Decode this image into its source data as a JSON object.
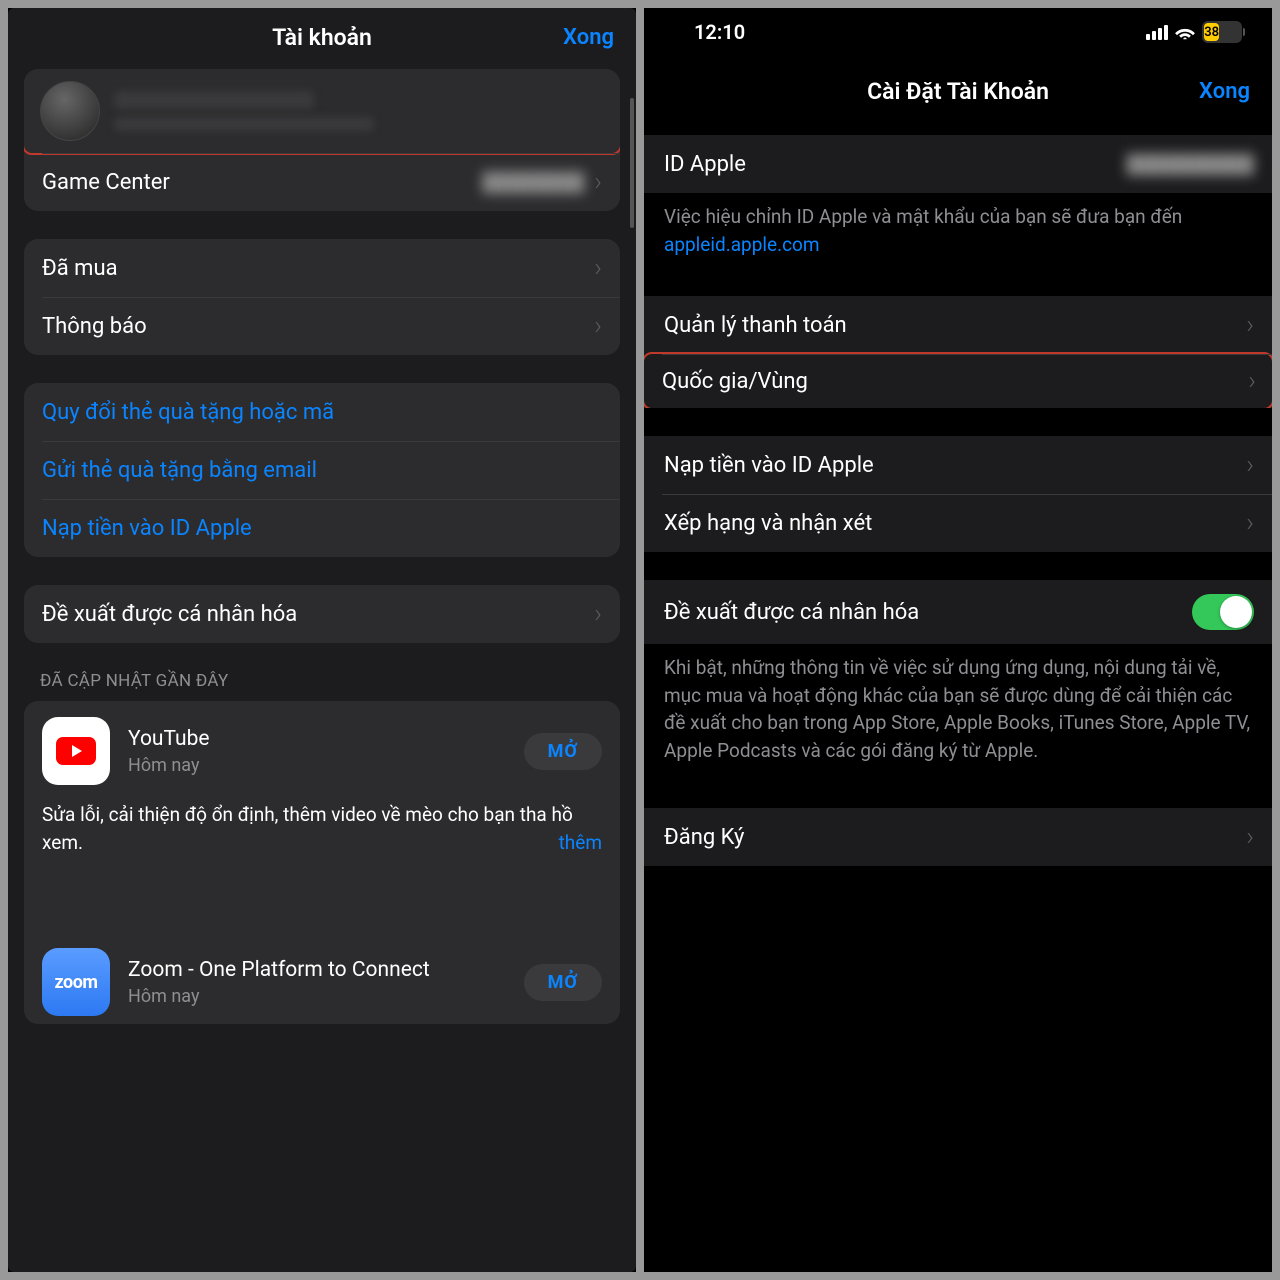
{
  "left": {
    "nav": {
      "title": "Tài khoản",
      "done": "Xong"
    },
    "profile": {
      "name_blur": "████████",
      "sub_blur": "████████████"
    },
    "gamecenter": {
      "label": "Game Center",
      "value_blur": "██████"
    },
    "rows2": {
      "purchased": "Đã mua",
      "notifications": "Thông báo"
    },
    "links": {
      "redeem": "Quy đổi thẻ quà tặng hoặc mã",
      "send_gift": "Gửi thẻ quà tặng bằng email",
      "add_funds": "Nạp tiền vào ID Apple"
    },
    "personalized": "Đề xuất được cá nhân hóa",
    "updates_header": "ĐÃ CẬP NHẬT GẦN ĐÂY",
    "youtube": {
      "name": "YouTube",
      "sub": "Hôm nay",
      "open": "Mở",
      "desc": "Sửa lỗi, cải thiện độ ổn định, thêm video về mèo cho bạn tha hồ xem.",
      "more": "thêm"
    },
    "zoom": {
      "name": "Zoom - One Platform to Connect",
      "sub": "Hôm nay",
      "open": "Mở"
    }
  },
  "right": {
    "status": {
      "time": "12:10",
      "battery": "38"
    },
    "nav": {
      "title": "Cài Đặt Tài Khoản",
      "done": "Xong"
    },
    "apple_id": {
      "label": "ID Apple",
      "value_blur": "████████"
    },
    "id_footer_pre": "Việc hiệu chỉnh ID Apple và mật khẩu của bạn sẽ đưa bạn đến ",
    "id_footer_link": "appleid.apple.com",
    "payment": "Quản lý thanh toán",
    "country": "Quốc gia/Vùng",
    "add_funds": "Nạp tiền vào ID Apple",
    "ratings": "Xếp hạng và nhận xét",
    "personalized": "Đề xuất được cá nhân hóa",
    "personalized_footer": "Khi bật, những thông tin về việc sử dụng ứng dụng, nội dung tải về, mục mua và hoạt động khác của bạn sẽ được dùng để cải thiện các đề xuất cho bạn trong App Store, Apple Books, iTunes Store, Apple TV, Apple Podcasts và các gói đăng ký từ Apple.",
    "subscriptions": "Đăng Ký"
  }
}
